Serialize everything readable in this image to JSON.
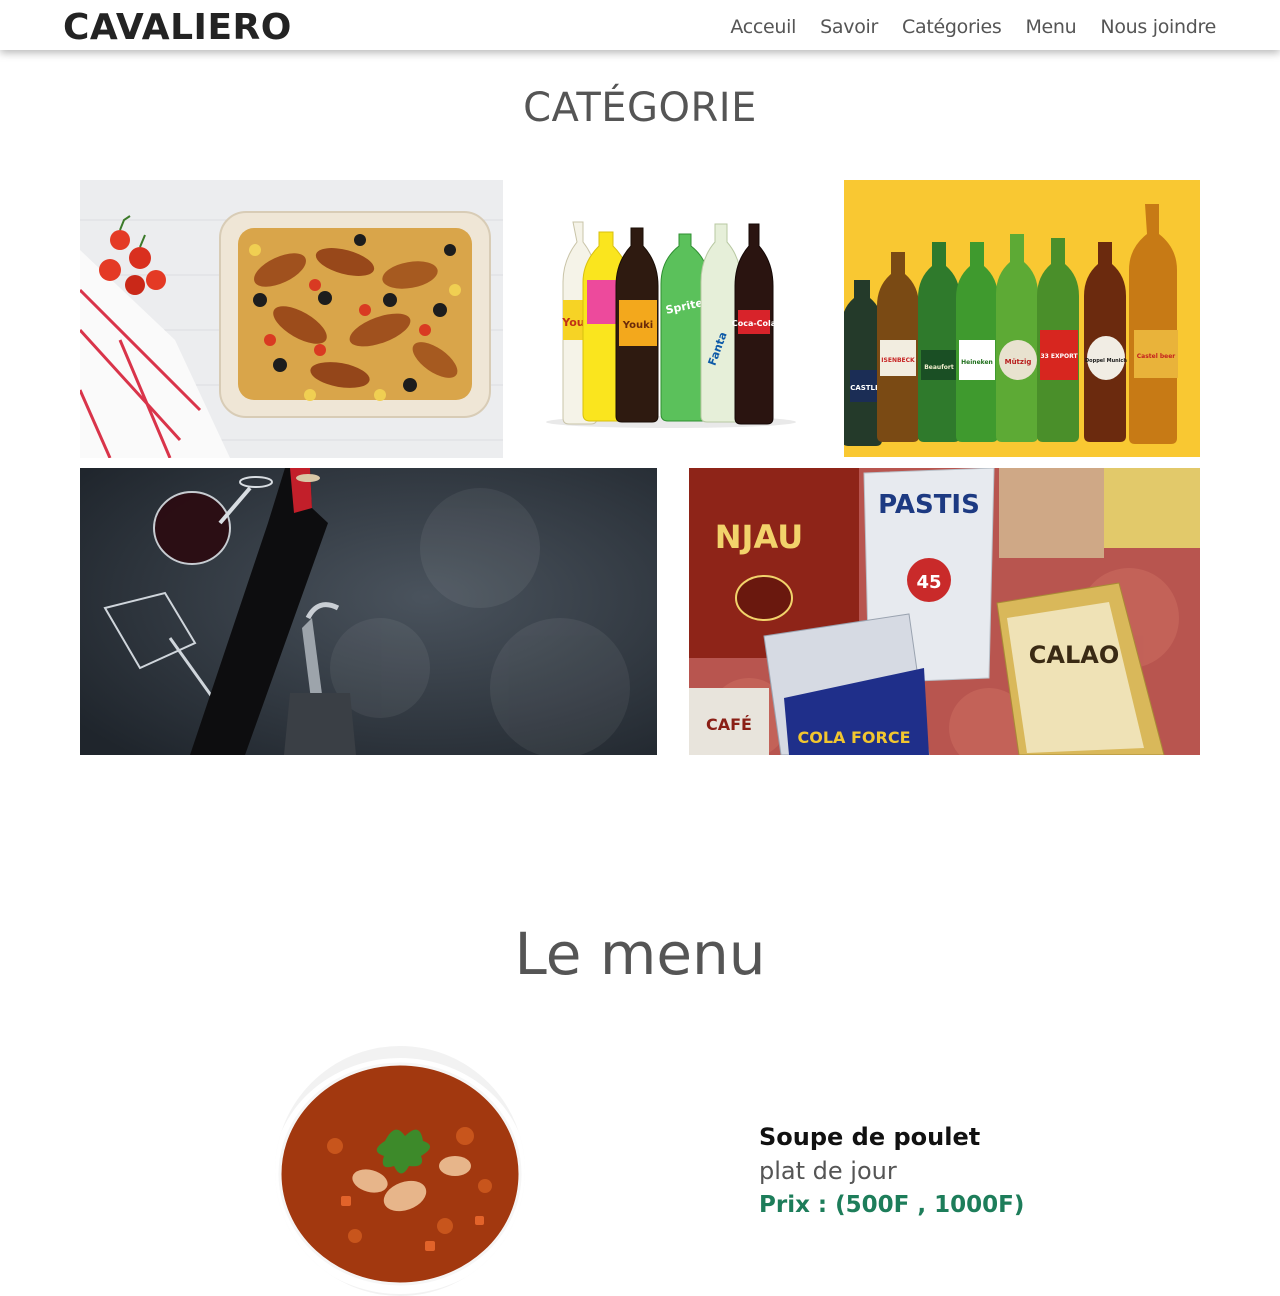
{
  "brand": "CAVALIERO",
  "nav": {
    "items": [
      {
        "label": "Acceuil"
      },
      {
        "label": "Savoir"
      },
      {
        "label": "Catégories"
      },
      {
        "label": "Menu"
      },
      {
        "label": "Nous joindre"
      }
    ]
  },
  "categories_section": {
    "title": "CATÉGORIE",
    "beer_labels": [
      "CASTLE",
      "ISENBECK",
      "Beaufort",
      "Heineken",
      "Mützig",
      "33 EXPORT",
      "Doppel Munich",
      "Castel beer"
    ],
    "soda_labels": [
      "Youki",
      "Sprite",
      "Fanta",
      "Coca-Cola"
    ],
    "sachet_labels": [
      "PASTIS",
      "45",
      "NJAU",
      "CALAO",
      "CAFÉ",
      "COLA FORCE"
    ]
  },
  "menu_section": {
    "title": "Le menu",
    "dish": {
      "name": "Soupe de poulet",
      "subtitle": "plat de jour",
      "price": "Prix : (500F , 1000F)"
    }
  },
  "colors": {
    "accent_price": "#1d7d5a",
    "beer_background": "#f9c832",
    "brand_text": "#232323"
  }
}
